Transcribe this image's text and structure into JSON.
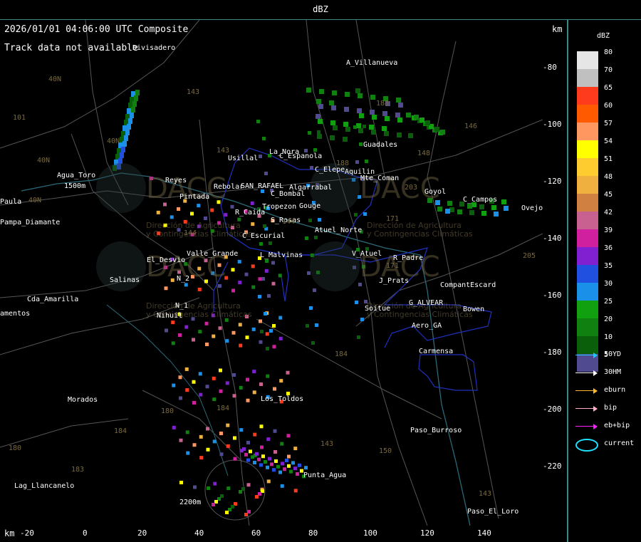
{
  "header": {
    "title": "dBZ"
  },
  "map": {
    "timestamp": "2026/01/01 04:06:00 UTC Composite",
    "track_status": "Track data not available",
    "km_top": "km",
    "km_bottom": "km",
    "y_ticks": [
      "-80",
      "-100",
      "-120",
      "-140",
      "-160",
      "-180",
      "-200",
      "-220"
    ],
    "x_ticks": [
      "-20",
      "0",
      "20",
      "40",
      "60",
      "80",
      "100",
      "120",
      "140"
    ],
    "places": [
      "Divisadero",
      "A_Villanueva",
      "Agua_Toro",
      "Usillal",
      "La_Nora",
      "C_Espanola",
      "C_Elepe",
      "Aquilin",
      "Mte_Coman",
      "Guadales",
      "Reyes",
      "Pintada",
      "Rebolar",
      "SAN_RAFAEL",
      "Algarrabal",
      "C_Bombal",
      "Tropezon",
      "Gouge",
      "Goyol",
      "C_Campos",
      "Ovejo",
      "Paula",
      "Pampa_Diamante",
      "El_Desvio",
      "Valle_Grande",
      "R_Caida",
      "S_Rosas",
      "Atuel_Norte",
      "C_Escurial",
      "L_Malvinas",
      "V_Atuel",
      "R_Padre",
      "J_Prats",
      "CompantEscard",
      "Salinas",
      "N_2",
      "N_1",
      "Nihuil",
      "Cda_Amarilla",
      "amentos",
      "Soitue",
      "G_ALVEAR",
      "Bowen",
      "Aero_GA",
      "Carmensa",
      "Morados",
      "Los_Toldos",
      "Paso_Burroso",
      "Punta_Agua",
      "Lag_Llancanelo",
      "Paso_El_Loro",
      "1500m",
      "2200m"
    ],
    "road_numbers": [
      "40N",
      "101",
      "143",
      "40N",
      "40N",
      "146",
      "188",
      "143",
      "171",
      "148",
      "203",
      "144",
      "144",
      "188",
      "205",
      "171",
      "180",
      "184",
      "184",
      "184",
      "180",
      "183",
      "143",
      "150",
      "143",
      "40N"
    ],
    "watermark_texts": [
      "DACC",
      "DACC",
      "DACC",
      "DACC",
      "Dirección de Agricultura",
      "y Contingencias Climáticas"
    ]
  },
  "legend": {
    "unit": "dBZ",
    "scale": [
      {
        "label": "80",
        "color": "#e6e6e6"
      },
      {
        "label": "70",
        "color": "#c0c0c0"
      },
      {
        "label": "65",
        "color": "#ff3b1e"
      },
      {
        "label": "60",
        "color": "#ff5a00"
      },
      {
        "label": "57",
        "color": "#ff9860"
      },
      {
        "label": "54",
        "color": "#ffff00"
      },
      {
        "label": "51",
        "color": "#ffcc30"
      },
      {
        "label": "48",
        "color": "#f0b040"
      },
      {
        "label": "45",
        "color": "#d08040"
      },
      {
        "label": "42",
        "color": "#c86090"
      },
      {
        "label": "39",
        "color": "#d020a0"
      },
      {
        "label": "36",
        "color": "#8020d0"
      },
      {
        "label": "35",
        "color": "#2050e0"
      },
      {
        "label": "30",
        "color": "#1a90e8"
      },
      {
        "label": "25",
        "color": "#10a010"
      },
      {
        "label": "20",
        "color": "#108010"
      },
      {
        "label": "10",
        "color": "#0a600a"
      },
      {
        "label": "5",
        "color": "#504a90"
      }
    ],
    "tracks": [
      {
        "label": "50YD",
        "color": "#1ec8ff"
      },
      {
        "label": "30HM",
        "color": "#ffffff"
      },
      {
        "label": "eburn",
        "color": "#ffb830"
      },
      {
        "label": "bip",
        "color": "#ffb0c8"
      },
      {
        "label": "eb+bip",
        "color": "#ff20ff"
      }
    ],
    "current_label": "current",
    "current_color": "#1ee0ff"
  }
}
